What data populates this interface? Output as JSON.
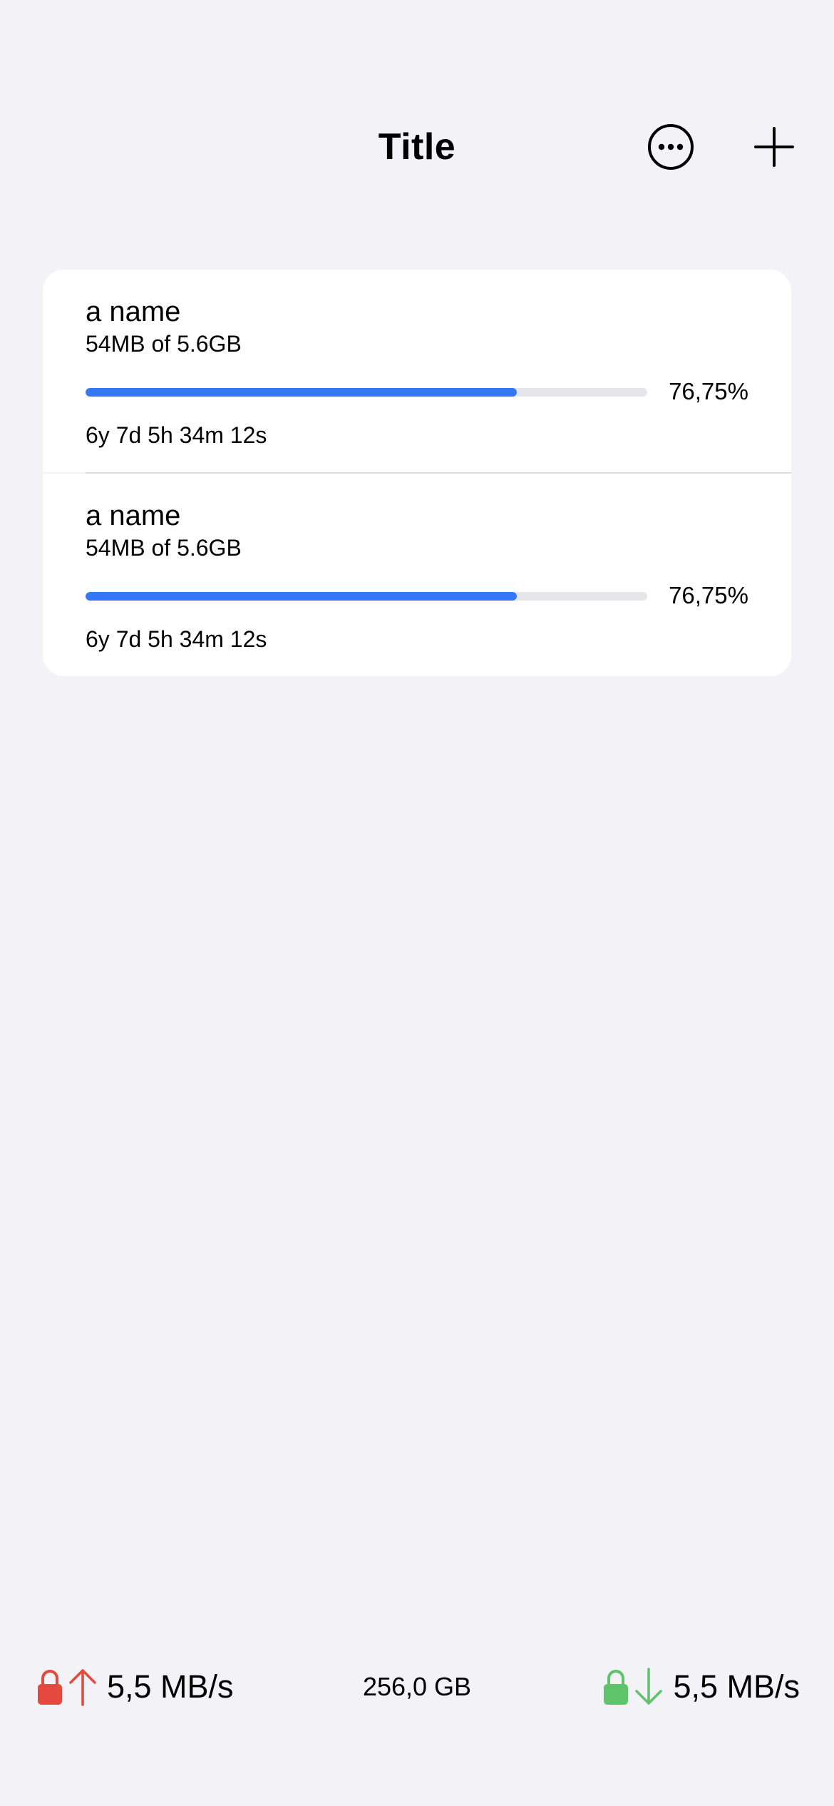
{
  "nav": {
    "title": "Title",
    "more_icon": "ellipsis-circle-icon",
    "add_icon": "plus-icon"
  },
  "items": [
    {
      "name": "a name",
      "size": "54MB of 5.6GB",
      "progress": 0.7675,
      "percent": "76,75%",
      "time": "6y 7d 5h 34m 12s"
    },
    {
      "name": "a name",
      "size": "54MB of 5.6GB",
      "progress": 0.7675,
      "percent": "76,75%",
      "time": "6y 7d 5h 34m 12s"
    }
  ],
  "footer": {
    "upload_speed": "5,5 MB/s",
    "storage": "256,0 GB",
    "download_speed": "5,5 MB/s",
    "upload_color": "#e5483c",
    "download_color": "#5fc36a",
    "progress_color": "#3478f6"
  }
}
